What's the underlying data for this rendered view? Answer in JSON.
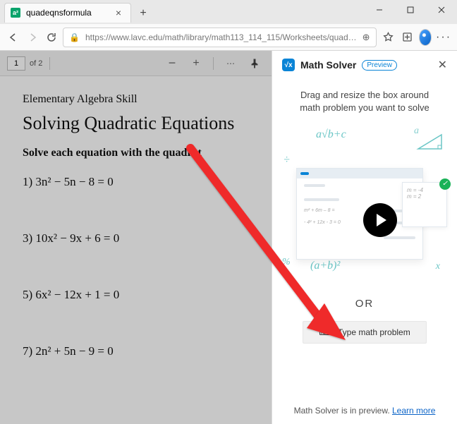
{
  "window": {
    "tab_title": "quadeqnsformula",
    "win_min": "—",
    "win_max": "▢",
    "win_close": "✕"
  },
  "toolbar": {
    "url_host": "https://www.lavc.edu",
    "url_path": "/math/library/math113_114_115/Worksheets/quad…",
    "more": "···"
  },
  "pdfbar": {
    "page": "1",
    "of": "of 2",
    "zoom_minus": "−",
    "zoom_plus": "+",
    "more": "⋯"
  },
  "doc": {
    "sub": "Elementary Algebra Skill",
    "title": "Solving Quadratic Equations",
    "instr": "Solve each equation with the quadrat",
    "problems": [
      "1)  3n² − 5n − 8 = 0",
      "3)  10x² − 9x + 6 = 0",
      "5)  6x² − 12x + 1 = 0",
      "7)  2n² + 5n − 9 = 0"
    ]
  },
  "panel": {
    "title": "Math Solver",
    "preview": "Preview",
    "msg": "Drag and resize the box around math problem you want to solve",
    "or": "OR",
    "type_btn": "Type math problem",
    "foot_text": "Math Solver is in preview. ",
    "foot_link": "Learn more",
    "deco_rt": "a√b+c",
    "deco_div": "÷",
    "deco_a": "a",
    "deco_ab": "(a+b)²",
    "deco_pct": "%",
    "deco_x": "x",
    "mock_eq1": "m² + 6m – 8 =",
    "mock_eq2": "- 4² + 12x - 3 = 0",
    "side_m1": "m = -4",
    "side_m2": "m =  2"
  }
}
